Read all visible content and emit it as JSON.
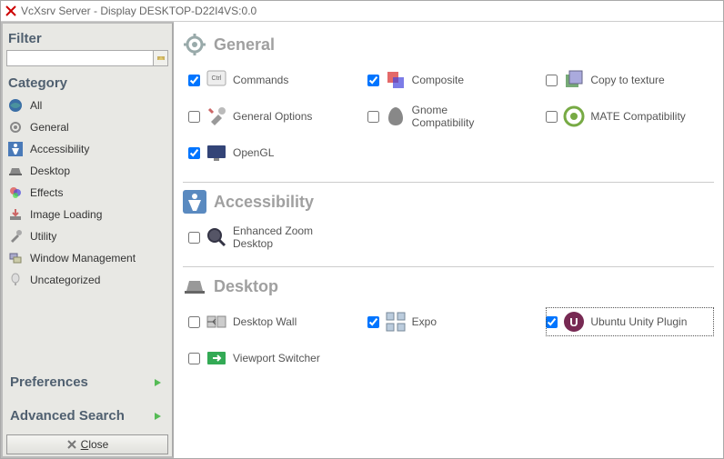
{
  "window": {
    "title": "VcXsrv Server - Display DESKTOP-D22I4VS:0.0"
  },
  "sidebar": {
    "filter_label": "Filter",
    "filter_value": "",
    "category_label": "Category",
    "categories": [
      {
        "id": "all",
        "label": "All"
      },
      {
        "id": "general",
        "label": "General"
      },
      {
        "id": "accessibility",
        "label": "Accessibility"
      },
      {
        "id": "desktop",
        "label": "Desktop"
      },
      {
        "id": "effects",
        "label": "Effects"
      },
      {
        "id": "image-loading",
        "label": "Image Loading"
      },
      {
        "id": "utility",
        "label": "Utility"
      },
      {
        "id": "window-management",
        "label": "Window Management"
      },
      {
        "id": "uncategorized",
        "label": "Uncategorized"
      }
    ],
    "preferences_label": "Preferences",
    "advanced_search_label": "Advanced Search",
    "close_label": "Close"
  },
  "sections": {
    "general": {
      "title": "General",
      "items": [
        {
          "label": "Commands",
          "checked": true,
          "icon": "commands"
        },
        {
          "label": "Composite",
          "checked": true,
          "icon": "composite"
        },
        {
          "label": "Copy to texture",
          "checked": false,
          "icon": "copy-texture"
        },
        {
          "label": "General Options",
          "checked": false,
          "icon": "wrench"
        },
        {
          "label": "Gnome Compatibility",
          "checked": false,
          "icon": "gnome"
        },
        {
          "label": "MATE Compatibility",
          "checked": false,
          "icon": "mate"
        },
        {
          "label": "OpenGL",
          "checked": true,
          "icon": "opengl"
        }
      ]
    },
    "accessibility": {
      "title": "Accessibility",
      "items": [
        {
          "label": "Enhanced Zoom Desktop",
          "checked": false,
          "icon": "zoom"
        }
      ]
    },
    "desktop": {
      "title": "Desktop",
      "items": [
        {
          "label": "Desktop Wall",
          "checked": false,
          "icon": "wall"
        },
        {
          "label": "Expo",
          "checked": true,
          "icon": "expo"
        },
        {
          "label": "Ubuntu Unity Plugin",
          "checked": true,
          "icon": "unity",
          "focused": true
        },
        {
          "label": "Viewport Switcher",
          "checked": false,
          "icon": "viewport"
        }
      ]
    }
  }
}
